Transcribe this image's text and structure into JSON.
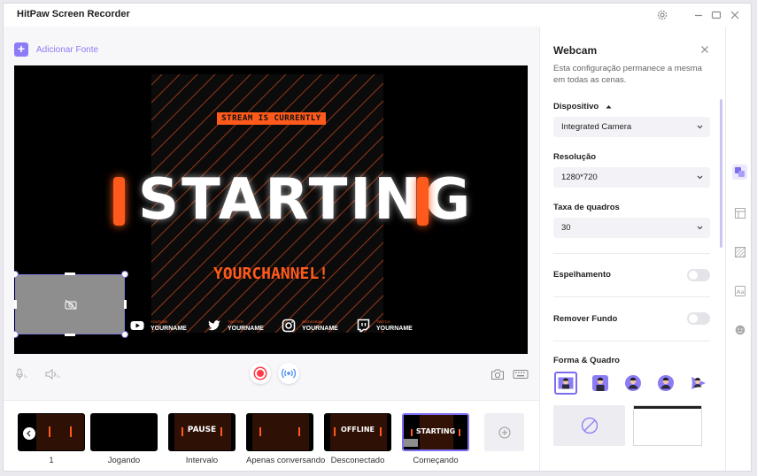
{
  "app": {
    "title": "HitPaw Screen Recorder"
  },
  "toolbar": {
    "add_source_label": "Adicionar Fonte"
  },
  "preview": {
    "stream_tag": "STREAM IS CURRENTLY",
    "headline": "STARTING",
    "channel": "YOURCHANNEL!",
    "socials": [
      {
        "icon": "youtube-icon",
        "service": "YOUTUBE",
        "name": "YOURNAME"
      },
      {
        "icon": "twitter-icon",
        "service": "TWITTER",
        "name": "YOURNAME"
      },
      {
        "icon": "instagram-icon",
        "service": "INSTAGRAM",
        "name": "YOURNAME"
      },
      {
        "icon": "twitch-icon",
        "service": "TWITCH",
        "name": "YOURNAME"
      }
    ]
  },
  "scenes": [
    {
      "name": "1",
      "overlay_text": ""
    },
    {
      "name": "Jogando",
      "overlay_text": ""
    },
    {
      "name": "Intervalo",
      "overlay_text": "PAUSE"
    },
    {
      "name": "Apenas conversando",
      "overlay_text": ""
    },
    {
      "name": "Desconectado",
      "overlay_text": "OFFLINE"
    },
    {
      "name": "Começando",
      "overlay_text": "STARTING",
      "active": true
    }
  ],
  "panel": {
    "title": "Webcam",
    "description": "Esta configuração permanece a mesma em todas as cenas.",
    "device_label": "Dispositivo",
    "device_value": "Integrated Camera",
    "resolution_label": "Resolução",
    "resolution_value": "1280*720",
    "framerate_label": "Taxa de quadros",
    "framerate_value": "30",
    "mirror_label": "Espelhamento",
    "mirror_on": false,
    "remove_bg_label": "Remover Fundo",
    "remove_bg_on": false,
    "shape_frame_label": "Forma & Quadro"
  },
  "colors": {
    "accent": "#8b7cf6",
    "overlay_orange": "#ff5a1c",
    "record_red": "#ff3b46"
  }
}
